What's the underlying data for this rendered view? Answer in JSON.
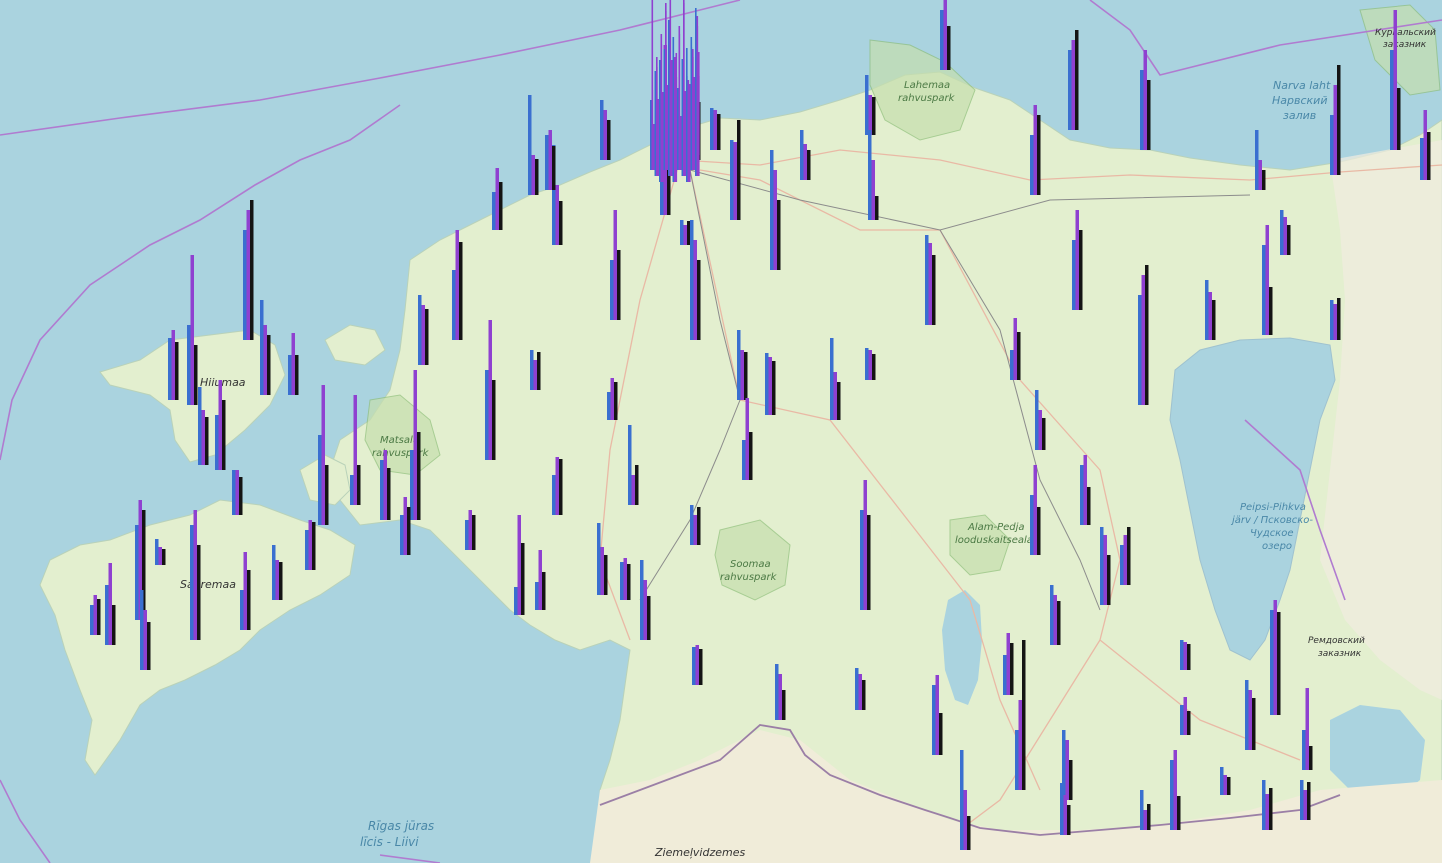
{
  "map": {
    "labels": {
      "hiiumaa": "Hiiumaa",
      "saaremaa": "Saaremaa",
      "matsalu_1": "Matsalu",
      "matsalu_2": "rahvuspark",
      "lahemaa_1": "Lahemaa",
      "lahemaa_2": "rahvuspark",
      "soomaa_1": "Soomaa",
      "soomaa_2": "rahvuspark",
      "alam_1": "Alam-Pedja",
      "alam_2": "looduskaitseala",
      "narva_1": "Narva laht",
      "narva_2": "Нарвский",
      "narva_3": "залив",
      "peipsi_1": "Peipsi-Pihkva",
      "peipsi_2": "järv / Псковско-",
      "peipsi_3": "Чудское",
      "peipsi_4": "озеро",
      "riga_1": "Rīgas jūras",
      "riga_2": "līcis - Liivi",
      "kurg_1": "Кургальский",
      "kurg_2": "заказник",
      "remd_1": "Ремдовский",
      "remd_2": "заказник",
      "ziemel": "Ziemeļvidzemes"
    },
    "series_colors": [
      "#3a6fd0",
      "#8f40d0",
      "#141414"
    ],
    "land_color": "#e3efcf",
    "water_color": "#aad3df"
  },
  "chart_data": {
    "type": "bar",
    "title": "",
    "series": [
      {
        "name": "",
        "color": "#3a6fd0"
      },
      {
        "name": "",
        "color": "#8f40d0"
      },
      {
        "name": "",
        "color": "#141414"
      }
    ],
    "values": [
      [
        62,
        70,
        58
      ],
      [
        80,
        150,
        60
      ],
      [
        110,
        130,
        140
      ],
      [
        95,
        70,
        60
      ],
      [
        40,
        62,
        40
      ],
      [
        78,
        55,
        48
      ],
      [
        55,
        90,
        70
      ],
      [
        45,
        45,
        38
      ],
      [
        90,
        140,
        60
      ],
      [
        30,
        110,
        40
      ],
      [
        26,
        18,
        16
      ],
      [
        95,
        120,
        110
      ],
      [
        115,
        130,
        95
      ],
      [
        40,
        78,
        60
      ],
      [
        55,
        40,
        38
      ],
      [
        40,
        50,
        48
      ],
      [
        70,
        150,
        88
      ],
      [
        70,
        60,
        56
      ],
      [
        70,
        110,
        98
      ],
      [
        90,
        140,
        80
      ],
      [
        38,
        62,
        48
      ],
      [
        100,
        40,
        36
      ],
      [
        100,
        60,
        44
      ],
      [
        55,
        60,
        44
      ],
      [
        60,
        50,
        40
      ],
      [
        60,
        110,
        70
      ],
      [
        25,
        20,
        24
      ],
      [
        120,
        100,
        80
      ],
      [
        80,
        78,
        100
      ],
      [
        120,
        100,
        70
      ],
      [
        50,
        36,
        30
      ],
      [
        60,
        40,
        38
      ],
      [
        90,
        60,
        24
      ],
      [
        60,
        78,
        44
      ],
      [
        60,
        90,
        80
      ],
      [
        80,
        90,
        100
      ],
      [
        70,
        100,
        80
      ],
      [
        80,
        100,
        70
      ],
      [
        60,
        30,
        20
      ],
      [
        45,
        38,
        30
      ],
      [
        60,
        90,
        110
      ],
      [
        100,
        140,
        62
      ],
      [
        42,
        70,
        48
      ],
      [
        60,
        48,
        40
      ],
      [
        90,
        110,
        48
      ],
      [
        40,
        36,
        42
      ],
      [
        110,
        130,
        140
      ],
      [
        30,
        62,
        48
      ],
      [
        60,
        40,
        32
      ],
      [
        90,
        82,
        70
      ],
      [
        32,
        30,
        26
      ],
      [
        82,
        48,
        38
      ],
      [
        70,
        50,
        48
      ],
      [
        62,
        58,
        54
      ],
      [
        40,
        82,
        48
      ],
      [
        28,
        42,
        38
      ],
      [
        80,
        30,
        40
      ],
      [
        40,
        58,
        56
      ],
      [
        28,
        100,
        72
      ],
      [
        30,
        40,
        35
      ],
      [
        40,
        58,
        48
      ],
      [
        60,
        70,
        52
      ],
      [
        72,
        48,
        40
      ],
      [
        38,
        42,
        36
      ],
      [
        80,
        60,
        44
      ],
      [
        40,
        30,
        38
      ],
      [
        100,
        130,
        95
      ],
      [
        42,
        36,
        30
      ],
      [
        56,
        46,
        30
      ],
      [
        38,
        40,
        36
      ],
      [
        70,
        80,
        42
      ],
      [
        100,
        60,
        34
      ],
      [
        40,
        62,
        52
      ],
      [
        60,
        50,
        44
      ],
      [
        60,
        90,
        48
      ],
      [
        60,
        70,
        38
      ],
      [
        78,
        70,
        50
      ],
      [
        40,
        50,
        58
      ],
      [
        30,
        28,
        26
      ],
      [
        30,
        38,
        24
      ],
      [
        70,
        60,
        52
      ],
      [
        100,
        60,
        80
      ],
      [
        40,
        82,
        24
      ],
      [
        50,
        60,
        48
      ],
      [
        28,
        20,
        18
      ],
      [
        50,
        36,
        42
      ],
      [
        40,
        30,
        38
      ],
      [
        70,
        80,
        34
      ],
      [
        40,
        20,
        26
      ],
      [
        70,
        60,
        40
      ],
      [
        60,
        90,
        150
      ],
      [
        52,
        40,
        30
      ],
      [
        100,
        170,
        48
      ],
      [
        70,
        80,
        58
      ],
      [
        42,
        40,
        36
      ],
      [
        40,
        30,
        38
      ],
      [
        28,
        60,
        38
      ],
      [
        80,
        60,
        48
      ],
      [
        60,
        82,
        40
      ],
      [
        30,
        40,
        36
      ]
    ]
  }
}
